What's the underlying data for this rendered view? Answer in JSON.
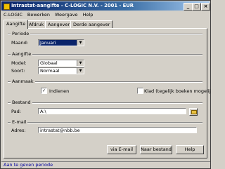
{
  "window": {
    "title": "Intrastat-aangifte - C-LOGIC N.V. - 2001 - EUR"
  },
  "menu": [
    "C-LOGIC",
    "Bewerken",
    "Weergave",
    "Help"
  ],
  "tabs": [
    "Aangifte",
    "Afdruk",
    "Aangever",
    "Derde aangever"
  ],
  "periode": {
    "group": "Periode",
    "maand_label": "Maand:",
    "maand_value": "Januari"
  },
  "aangifte": {
    "group": "Aangifte",
    "model_label": "Model:",
    "model_value": "Globaal",
    "soort_label": "Soort:",
    "soort_value": "Normaal"
  },
  "aanmaak": {
    "group": "Aanmaak",
    "indienen_label": "Indienen",
    "indienen_checked": true,
    "klad_label": "Klad (tegelijk boeken mogelijk)",
    "klad_checked": false
  },
  "bestand": {
    "group": "Bestand",
    "pad_label": "Pad:",
    "pad_value": "A:\\"
  },
  "email": {
    "group": "E-mail",
    "adres_label": "Adres:",
    "adres_value": "intrastat@nbb.be"
  },
  "buttons": {
    "via_email": "via E-mail",
    "naar_bestand": "Naar bestand",
    "help": "Help"
  },
  "status": "Aan te geven periode"
}
